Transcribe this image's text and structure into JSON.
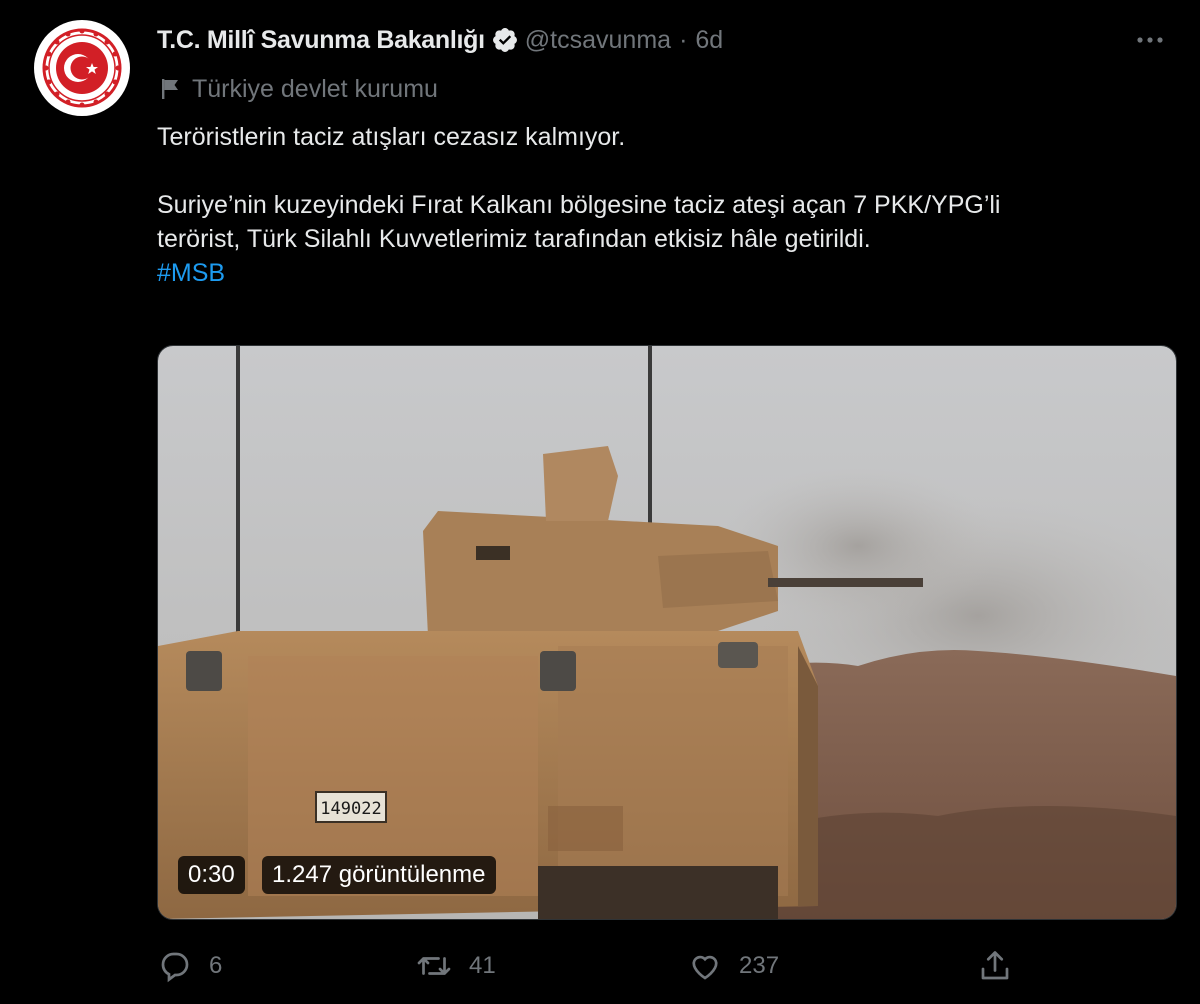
{
  "tweet": {
    "author_name": "T.C. Millî Savunma Bakanlığı",
    "handle": "@tcsavunma",
    "separator": "·",
    "time": "6d",
    "affiliation": "Türkiye devlet kurumu",
    "line1": "Teröristlerin taciz atışları cezasız kalmıyor.",
    "line2": "Suriye’nin kuzeyindeki Fırat Kalkanı bölgesine taciz ateşi açan 7 PKK/YPG’li",
    "line3": "terörist, Türk Silahlı Kuvvetlerimiz tarafından etkisiz hâle getirildi.",
    "hashtag": "#MSB"
  },
  "video": {
    "duration": "0:30",
    "views": "1.247 görüntülenme",
    "vehicle_plate": "149022"
  },
  "actions": {
    "reply_count": "6",
    "retweet_count": "41",
    "like_count": "237"
  },
  "icons": [
    "verified-badge-icon",
    "more-icon",
    "flag-icon",
    "reply-icon",
    "retweet-icon",
    "like-icon",
    "share-icon"
  ],
  "colors": {
    "background": "#000000",
    "text": "#e7e9ea",
    "secondary": "#71767b",
    "link": "#1d9bf0",
    "logo_red": "#d21f26"
  }
}
